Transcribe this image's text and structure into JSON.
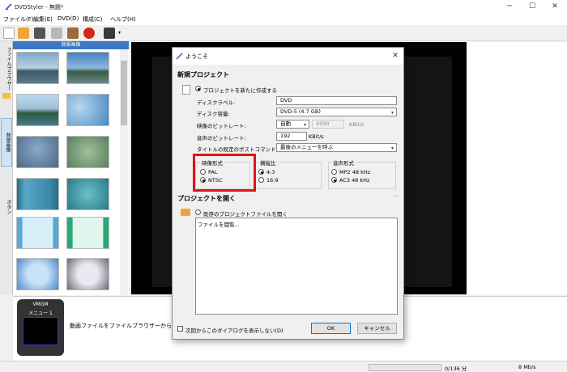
{
  "window": {
    "title": "DVDStyler - 無題*"
  },
  "menu": [
    "ファイル(F)",
    "編集(E)",
    "DVD(D)",
    "構成(C)",
    "ヘルプ(H)"
  ],
  "sidetabs": [
    "ファイルブラウザー",
    "背景画像",
    "ボタン"
  ],
  "thumbpanel": {
    "header": "背景画像"
  },
  "vmgm": {
    "title": "VMGM",
    "menu": "メニュー 1"
  },
  "hint": "動画ファイルをファイルブラウザーからここにドラ",
  "status": {
    "duration": "0/136 分",
    "rate": "8 Mb/s"
  },
  "dialog": {
    "title": "ようこそ",
    "new_project": {
      "heading": "新規プロジェクト",
      "create_radio": "プロジェクトを新たに作成する",
      "disc_label_lbl": "ディスクラベル:",
      "disc_label_val": "DVD",
      "disc_capacity_lbl": "ディスク容量:",
      "disc_capacity_val": "DVD-5 (4.7 GB)",
      "video_bitrate_lbl": "映像のビットレート:",
      "video_bitrate_mode": "自動",
      "video_bitrate_val": "4500",
      "video_bitrate_unit": "KBit/s",
      "audio_bitrate_lbl": "音声のビットレート:",
      "audio_bitrate_val": "192",
      "audio_bitrate_unit": "KBit/s",
      "post_cmd_lbl": "タイトルの既定のポストコマンド:",
      "post_cmd_val": "最後のメニューを呼ぶ",
      "video_format": {
        "title": "映像形式",
        "options": [
          "PAL",
          "NTSC"
        ],
        "selected": "NTSC"
      },
      "aspect": {
        "title": "横縦比",
        "options": [
          "4:3",
          "16:9"
        ],
        "selected": "4:3"
      },
      "audio_format": {
        "title": "音声形式",
        "options": [
          "MP2 48 kHz",
          "AC3 48 kHz"
        ],
        "selected": "AC3 48 kHz"
      }
    },
    "open_project": {
      "heading": "プロジェクトを開く",
      "open_radio": "既存のプロジェクトファイルを開く",
      "list_item": "ファイルを閲覧..."
    },
    "dont_show": "次回からこのダイアログを表示しない(D)",
    "ok": "OK",
    "cancel": "キャンセル"
  },
  "colors": {
    "highlight": "#e0121b",
    "accent": "#3c78c8"
  }
}
